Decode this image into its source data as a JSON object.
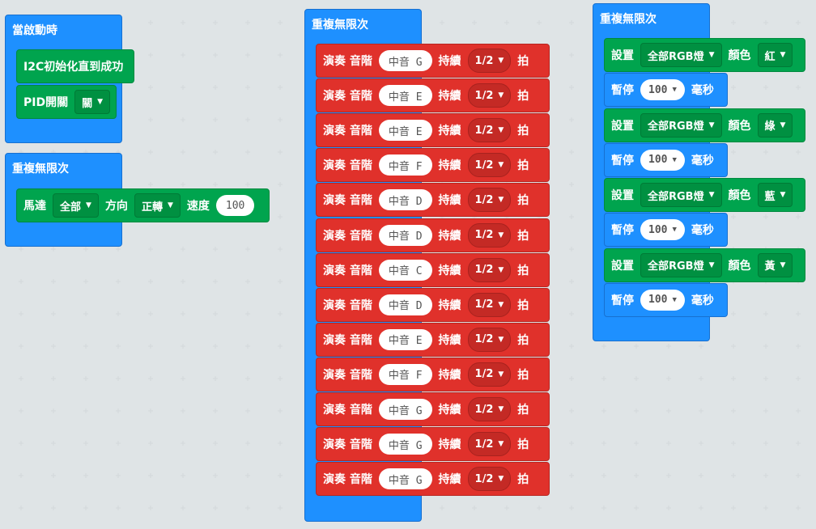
{
  "colors": {
    "background": "#ecf0f1",
    "event_blue": "#1e90ff",
    "motor_green": "#00a44e",
    "music_red": "#e0312b"
  },
  "stack1": {
    "title": "當啟動時",
    "init_label": "I2C初始化直到成功",
    "pid_label": "PID開關",
    "pid_value": "關"
  },
  "stack2": {
    "title": "重複無限次",
    "motor_label": "馬達",
    "motor_target": "全部",
    "direction_label": "方向",
    "direction_value": "正轉",
    "speed_label": "速度",
    "speed_value": "100"
  },
  "stack3": {
    "title": "重複無限次",
    "play_label": "演奏 音階",
    "duration_label": "持續",
    "beat_unit": "拍",
    "notes": [
      {
        "tone": "中音 G",
        "duration": "1/2"
      },
      {
        "tone": "中音 E",
        "duration": "1/2"
      },
      {
        "tone": "中音 E",
        "duration": "1/2"
      },
      {
        "tone": "中音 F",
        "duration": "1/2"
      },
      {
        "tone": "中音 D",
        "duration": "1/2"
      },
      {
        "tone": "中音 D",
        "duration": "1/2"
      },
      {
        "tone": "中音 C",
        "duration": "1/2"
      },
      {
        "tone": "中音 D",
        "duration": "1/2"
      },
      {
        "tone": "中音 E",
        "duration": "1/2"
      },
      {
        "tone": "中音 F",
        "duration": "1/2"
      },
      {
        "tone": "中音 G",
        "duration": "1/2"
      },
      {
        "tone": "中音 G",
        "duration": "1/2"
      },
      {
        "tone": "中音 G",
        "duration": "1/2"
      }
    ]
  },
  "stack4": {
    "title": "重複無限次",
    "set_label": "設置",
    "target": "全部RGB燈",
    "color_label": "顏色",
    "pause_label": "暫停",
    "ms_label": "毫秒",
    "steps": [
      {
        "color": "紅",
        "pause": "100"
      },
      {
        "color": "綠",
        "pause": "100"
      },
      {
        "color": "藍",
        "pause": "100"
      },
      {
        "color": "黃",
        "pause": "100"
      }
    ]
  }
}
